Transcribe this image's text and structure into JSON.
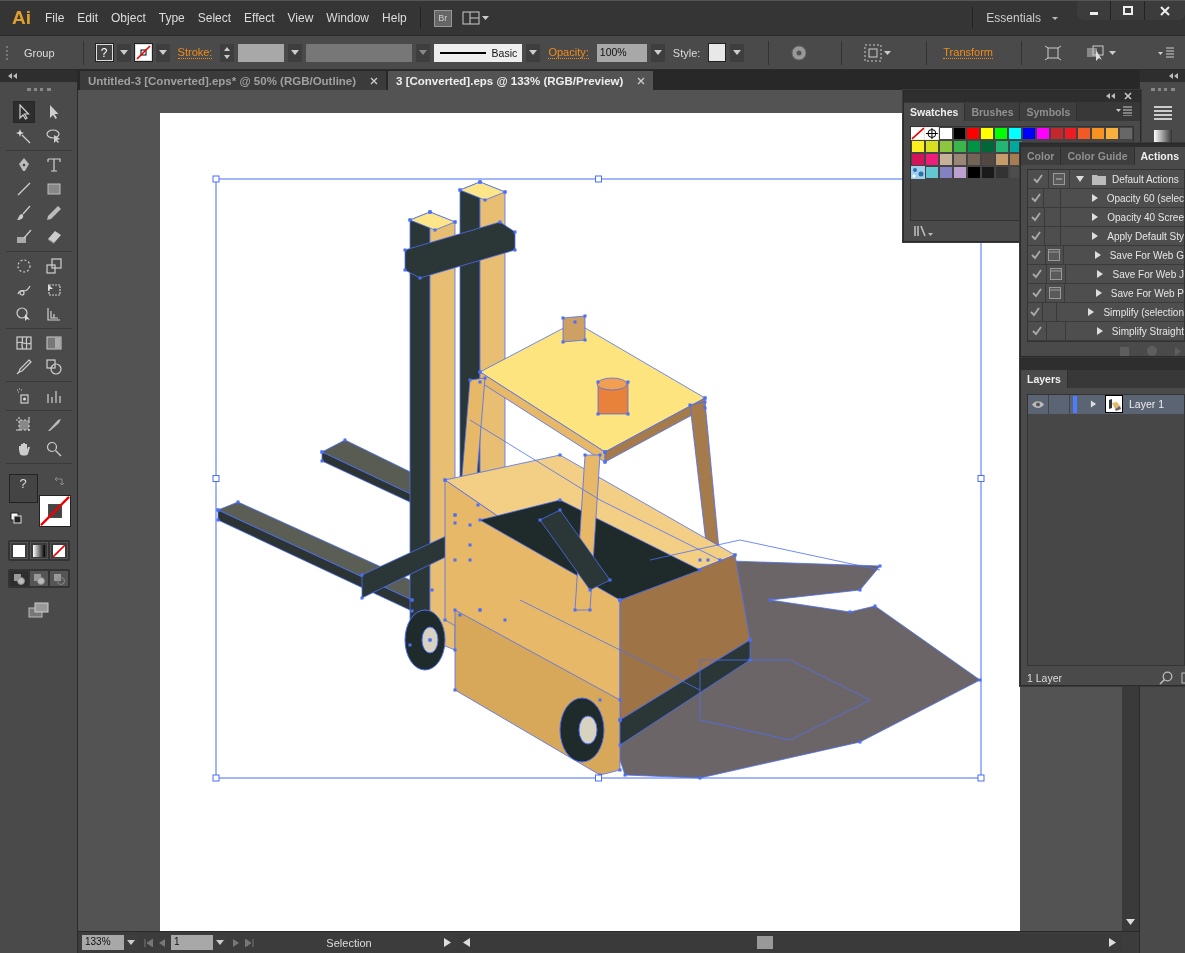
{
  "app": {
    "logo": "Ai",
    "menus": [
      "File",
      "Edit",
      "Object",
      "Type",
      "Select",
      "Effect",
      "View",
      "Window",
      "Help"
    ],
    "bridge": "Br",
    "workspace": "Essentials"
  },
  "control_bar": {
    "selection": "Group",
    "fill": "?",
    "stroke_label": "Stroke:",
    "brush": "Basic",
    "opacity_label": "Opacity:",
    "opacity": "100%",
    "style_label": "Style:",
    "transform": "Transform"
  },
  "document_tabs": [
    {
      "title": "Untitled-3 [Converted].eps* @ 50% (RGB/Outline)",
      "selected": false
    },
    {
      "title": "3 [Converted].eps @ 133% (RGB/Preview)",
      "selected": true
    }
  ],
  "tools": [
    {
      "kind": "selection",
      "selected": true
    },
    {
      "kind": "direct-selection",
      "selected": false
    },
    {
      "kind": "magic-wand",
      "selected": false
    },
    {
      "kind": "lasso",
      "selected": false
    },
    {
      "kind": "pen",
      "selected": false
    },
    {
      "kind": "type",
      "selected": false
    },
    {
      "kind": "line",
      "selected": false
    },
    {
      "kind": "rectangle",
      "selected": false
    },
    {
      "kind": "paintbrush",
      "selected": false
    },
    {
      "kind": "pencil",
      "selected": false
    },
    {
      "kind": "blob-brush",
      "selected": false
    },
    {
      "kind": "eraser",
      "selected": false
    },
    {
      "kind": "rotate",
      "selected": false
    },
    {
      "kind": "scale",
      "selected": false
    },
    {
      "kind": "warp",
      "selected": false
    },
    {
      "kind": "free-transform",
      "selected": false
    },
    {
      "kind": "shape-builder",
      "selected": false
    },
    {
      "kind": "perspective",
      "selected": false
    },
    {
      "kind": "mesh",
      "selected": false
    },
    {
      "kind": "gradient",
      "selected": false
    },
    {
      "kind": "eyedropper",
      "selected": false
    },
    {
      "kind": "blend",
      "selected": false
    },
    {
      "kind": "sprayer",
      "selected": false
    },
    {
      "kind": "graph",
      "selected": false
    },
    {
      "kind": "artboard",
      "selected": false
    },
    {
      "kind": "slice",
      "selected": false
    },
    {
      "kind": "hand",
      "selected": false
    },
    {
      "kind": "zoom",
      "selected": false
    }
  ],
  "fill_stroke": {
    "fill": "?",
    "stroke": {
      "kind": "none"
    }
  },
  "draw_modes": [
    {
      "selected": true
    },
    {
      "selected": false
    },
    {
      "selected": false
    }
  ],
  "swatches_panel": {
    "tabs": [
      {
        "label": "Swatches",
        "selected": true
      },
      {
        "label": "Brushes",
        "selected": false
      },
      {
        "label": "Symbols",
        "selected": false
      }
    ],
    "rows": [
      [
        {
          "kind": "none"
        },
        {
          "kind": "registration"
        },
        {
          "kind": "color",
          "color": "#ffffff"
        },
        {
          "kind": "color",
          "color": "#000000"
        },
        {
          "kind": "color",
          "color": "#ff0000"
        },
        {
          "kind": "color",
          "color": "#ffff00"
        },
        {
          "kind": "color",
          "color": "#00ff00"
        },
        {
          "kind": "color",
          "color": "#00ffff"
        },
        {
          "kind": "color",
          "color": "#0000ff"
        },
        {
          "kind": "color",
          "color": "#ff00ff"
        },
        {
          "kind": "color",
          "color": "#c1272d"
        },
        {
          "kind": "color",
          "color": "#ed1c24"
        },
        {
          "kind": "color",
          "color": "#f15a24"
        },
        {
          "kind": "color",
          "color": "#f7931e"
        },
        {
          "kind": "color",
          "color": "#fbb03b"
        },
        {
          "kind": "color",
          "color": "#676767"
        }
      ],
      [
        {
          "kind": "color",
          "color": "#fcee21"
        },
        {
          "kind": "color",
          "color": "#d9e021"
        },
        {
          "kind": "color",
          "color": "#8cc63f"
        },
        {
          "kind": "color",
          "color": "#39b54a"
        },
        {
          "kind": "color",
          "color": "#009245"
        },
        {
          "kind": "color",
          "color": "#006837"
        },
        {
          "kind": "color",
          "color": "#22b573"
        },
        {
          "kind": "color",
          "color": "#00a99d"
        }
      ],
      [
        {
          "kind": "color",
          "color": "#d4145a"
        },
        {
          "kind": "color",
          "color": "#ed1e79"
        },
        {
          "kind": "color",
          "color": "#c7b299"
        },
        {
          "kind": "color",
          "color": "#998675"
        },
        {
          "kind": "color",
          "color": "#736357"
        },
        {
          "kind": "color",
          "color": "#534741"
        },
        {
          "kind": "color",
          "color": "#c69c6d"
        },
        {
          "kind": "color",
          "color": "#a67c52"
        }
      ],
      [
        {
          "kind": "pattern"
        },
        {
          "kind": "color",
          "color": "#63c6d0"
        },
        {
          "kind": "color",
          "color": "#8381c2"
        },
        {
          "kind": "color",
          "color": "#bd9fd0"
        },
        {
          "kind": "color",
          "color": "#000000"
        },
        {
          "kind": "color",
          "color": "#1a1a1a"
        },
        {
          "kind": "color",
          "color": "#333333"
        },
        {
          "kind": "color",
          "color": "#4d4d4d"
        }
      ]
    ]
  },
  "actions_panel": {
    "tabs": [
      {
        "label": "Color",
        "selected": false
      },
      {
        "label": "Color Guide",
        "selected": false
      },
      {
        "label": "Actions",
        "selected": true
      }
    ],
    "items": [
      {
        "label": "Default Actions",
        "enabled": true,
        "dialog": true,
        "expanded": true,
        "children": [
          {
            "label": "Opacity 60 (selec",
            "enabled": true,
            "dialog": false,
            "expanded": false
          },
          {
            "label": "Opacity 40 Scree",
            "enabled": true,
            "dialog": false,
            "expanded": false
          },
          {
            "label": "Apply Default Sty",
            "enabled": true,
            "dialog": false,
            "expanded": false
          },
          {
            "label": "Save For Web G",
            "enabled": true,
            "dialog": true,
            "expanded": false
          },
          {
            "label": "Save For Web J",
            "enabled": true,
            "dialog": true,
            "expanded": false
          },
          {
            "label": "Save For Web P",
            "enabled": true,
            "dialog": true,
            "expanded": false
          },
          {
            "label": "Simplify (selection",
            "enabled": true,
            "dialog": false,
            "expanded": false
          },
          {
            "label": "Simplify Straight",
            "enabled": true,
            "dialog": false,
            "expanded": false
          }
        ]
      }
    ]
  },
  "layers_panel": {
    "title": "Layers",
    "layers": [
      {
        "name": "Layer 1",
        "visible": true,
        "expanded": false,
        "color": "#4f7cff"
      }
    ],
    "footer": "1 Layer"
  },
  "status_bar": {
    "zoom": "133%",
    "artboard": "1",
    "status": "Selection"
  }
}
